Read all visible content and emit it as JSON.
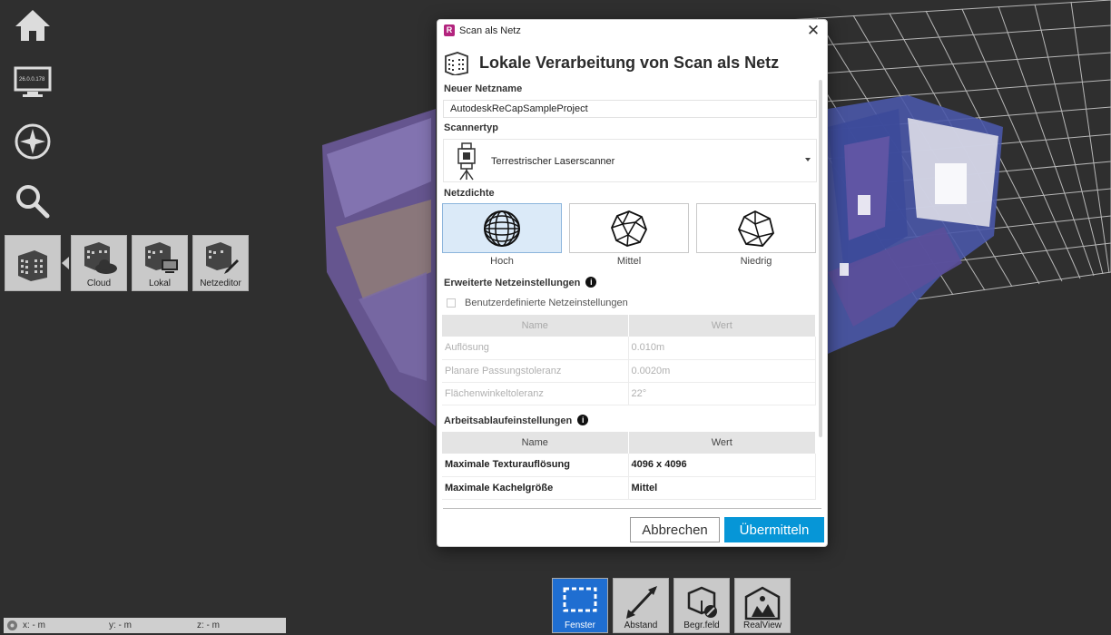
{
  "left_toolbar": {
    "display_ip": "26.0.0.178",
    "mesh_tiles": [
      {
        "label": ""
      },
      {
        "label": "Cloud"
      },
      {
        "label": "Lokal"
      },
      {
        "label": "Netzeditor"
      }
    ]
  },
  "bottom_toolbar": {
    "tools": [
      {
        "label": "Fenster",
        "active": true
      },
      {
        "label": "Abstand",
        "active": false
      },
      {
        "label": "Begr.feld",
        "active": false
      },
      {
        "label": "RealView",
        "active": false
      }
    ]
  },
  "coordinates": {
    "x": "x:  - m",
    "y": "y:  - m",
    "z": "z:  - m"
  },
  "dialog": {
    "badge": "R",
    "title": "Scan als Netz",
    "close": "✕",
    "heading": "Lokale Verarbeitung von Scan als Netz",
    "mesh_name_label": "Neuer Netzname",
    "mesh_name_value": "AutodeskReCapSampleProject",
    "scanner_type_label": "Scannertyp",
    "scanner_type_value": "Terrestrischer Laserscanner",
    "density_label": "Netzdichte",
    "density_options": [
      {
        "label": "Hoch",
        "selected": true
      },
      {
        "label": "Mittel",
        "selected": false
      },
      {
        "label": "Niedrig",
        "selected": false
      }
    ],
    "advanced_label": "Erweiterte Netzeinstellungen",
    "custom_settings_label": "Benutzerdefinierte Netzeinstellungen",
    "custom_settings_checked": false,
    "advanced_table": {
      "headers": [
        "Name",
        "Wert"
      ],
      "rows": [
        [
          "Auflösung",
          "0.010m"
        ],
        [
          "Planare Passungstoleranz",
          "0.0020m"
        ],
        [
          "Flächenwinkeltoleranz",
          "22°"
        ]
      ]
    },
    "workflow_label": "Arbeitsablaufeinstellungen",
    "workflow_table": {
      "headers": [
        "Name",
        "Wert"
      ],
      "rows": [
        [
          "Maximale Texturauflösung",
          "4096 x 4096"
        ],
        [
          "Maximale Kachelgröße",
          "Mittel"
        ]
      ]
    },
    "cancel_label": "Abbrechen",
    "submit_label": "Übermitteln"
  },
  "colors": {
    "background": "#2f2f2f",
    "accent_blue": "#0696d7",
    "active_tool": "#1f6ed1",
    "selected_density": "#dbeaf8",
    "revit_badge": "#b3247e"
  }
}
